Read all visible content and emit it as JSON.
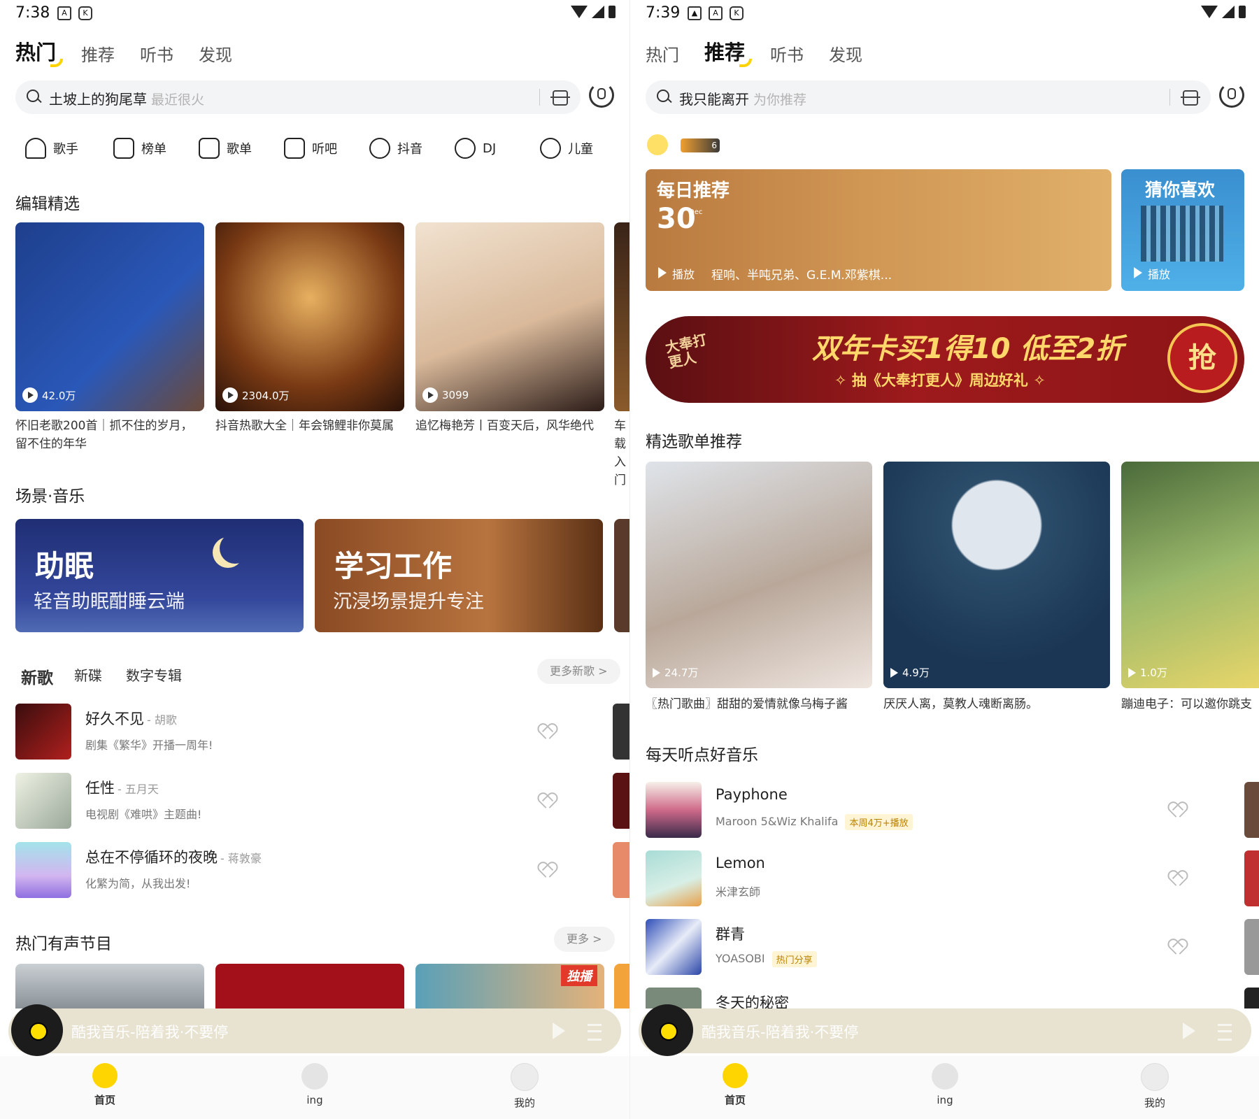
{
  "left": {
    "status": {
      "time": "7:38"
    },
    "tabs": [
      "热门",
      "推荐",
      "听书",
      "发现"
    ],
    "active_tab": 0,
    "search": {
      "keyword": "土坡上的狗尾草",
      "hint": "最近很火"
    },
    "categories": [
      "歌手",
      "榜单",
      "歌单",
      "听吧",
      "抖音",
      "DJ",
      "儿童"
    ],
    "editor_section": "编辑精选",
    "editor_cards": [
      {
        "plays": "42.0万",
        "title": "怀旧老歌200首｜抓不住的岁月，留不住的年华"
      },
      {
        "plays": "2304.0万",
        "title": "抖音热歌大全｜年会锦鲤非你莫属"
      },
      {
        "plays": "3099",
        "title": "追忆梅艳芳丨百变天后，风华绝代"
      },
      {
        "plays": "",
        "title": "车载入门"
      }
    ],
    "scene_section": "场景·音乐",
    "scenes": [
      {
        "title": "助眠",
        "subtitle": "轻音助眠酣睡云端"
      },
      {
        "title": "学习工作",
        "subtitle": "沉浸场景提升专注"
      }
    ],
    "new_tabs": [
      "新歌",
      "新碟",
      "数字专辑"
    ],
    "more_new": "更多新歌 >",
    "songs": [
      {
        "name": "好久不见",
        "artist": "- 胡歌",
        "desc": "剧集《繁华》开播一周年!"
      },
      {
        "name": "任性",
        "artist": "- 五月天",
        "desc": "电视剧《难哄》主题曲!"
      },
      {
        "name": "总在不停循环的夜晚",
        "artist": "- 蒋敦豪",
        "desc": "化繁为简，从我出发!"
      }
    ],
    "audio_section": "热门有声节目",
    "more": "更多 >",
    "exclusive": "独播",
    "player_text": "酷我音乐-陪着我·不要停",
    "nav": [
      "首页",
      "ing",
      "我的"
    ]
  },
  "right": {
    "status": {
      "time": "7:39"
    },
    "tabs": [
      "热门",
      "推荐",
      "听书",
      "发现"
    ],
    "active_tab": 1,
    "search": {
      "keyword": "我只能离开",
      "hint": "为你推荐"
    },
    "badge": "6",
    "daily": {
      "title": "每日推荐",
      "day": "30",
      "month": "Dec",
      "play": "播放",
      "artists": "程响、半吨兄弟、G.E.M.邓紫棋..."
    },
    "guess": {
      "title": "猜你喜欢",
      "play": "播放"
    },
    "banner": {
      "headline": "双年卡买1得10 低至2折",
      "sub": "✧ 抽《大奉打更人》周边好礼 ✧",
      "button": "抢",
      "logo": "大奉打更人"
    },
    "playlist_section": "精选歌单推荐",
    "playlists": [
      {
        "plays": "24.7万",
        "title": "〖热门歌曲〗甜甜的爱情就像乌梅子酱"
      },
      {
        "plays": "4.9万",
        "title": "厌厌人离，莫教人魂断离肠。"
      },
      {
        "plays": "1.0万",
        "title": "蹦迪电子：可以邀你跳支"
      }
    ],
    "daily_section": "每天听点好音乐",
    "songs": [
      {
        "name": "Payphone",
        "artist": "Maroon 5&Wiz Khalifa",
        "tag": "本周4万+播放"
      },
      {
        "name": "Lemon",
        "artist": "米津玄師",
        "tag": ""
      },
      {
        "name": "群青",
        "artist": "YOASOBI",
        "tag": "热门分享"
      },
      {
        "name": "冬天的秘密",
        "artist": "",
        "tag": ""
      }
    ],
    "player_text": "酷我音乐-陪着我·不要停",
    "nav": [
      "首页",
      "ing",
      "我的"
    ]
  }
}
